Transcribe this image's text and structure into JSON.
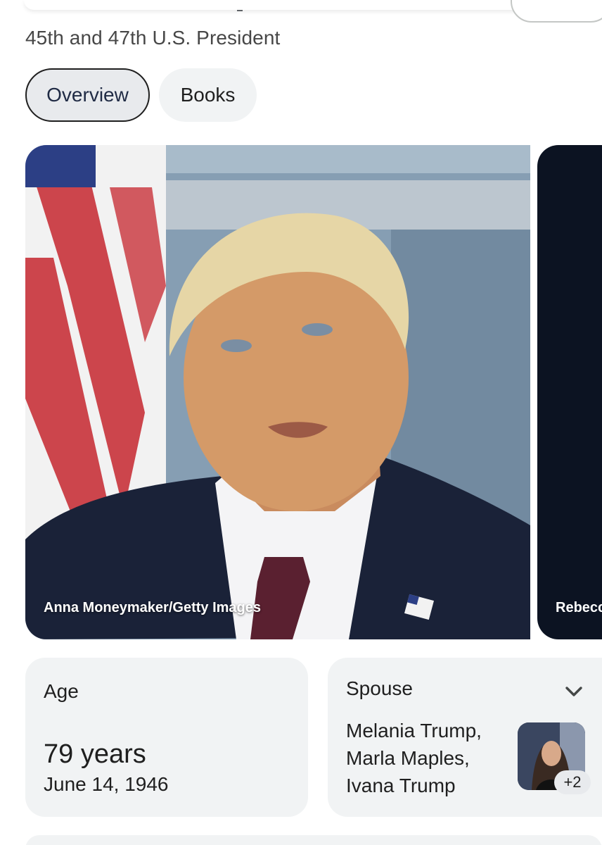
{
  "header": {
    "subtitle": "45th and 47th U.S. President"
  },
  "tabs": [
    {
      "label": "Overview",
      "selected": true
    },
    {
      "label": "Books",
      "selected": false
    }
  ],
  "images": {
    "main_credit": "Anna Moneymaker/Getty Images",
    "next_credit": "Rebecc"
  },
  "facts": {
    "age": {
      "label": "Age",
      "value": "79 years",
      "detail": "June 14, 1946"
    },
    "spouse": {
      "label": "Spouse",
      "names": [
        "Melania Trump,",
        "Marla Maples,",
        "Ivana Trump"
      ],
      "more_badge": "+2",
      "expand_icon": "chevron-down-icon"
    }
  },
  "colors": {
    "chip_selected_border": "#1f1f1f",
    "card_background": "#f1f3f4",
    "text_primary": "#1f1f1f",
    "text_secondary": "#474747"
  }
}
